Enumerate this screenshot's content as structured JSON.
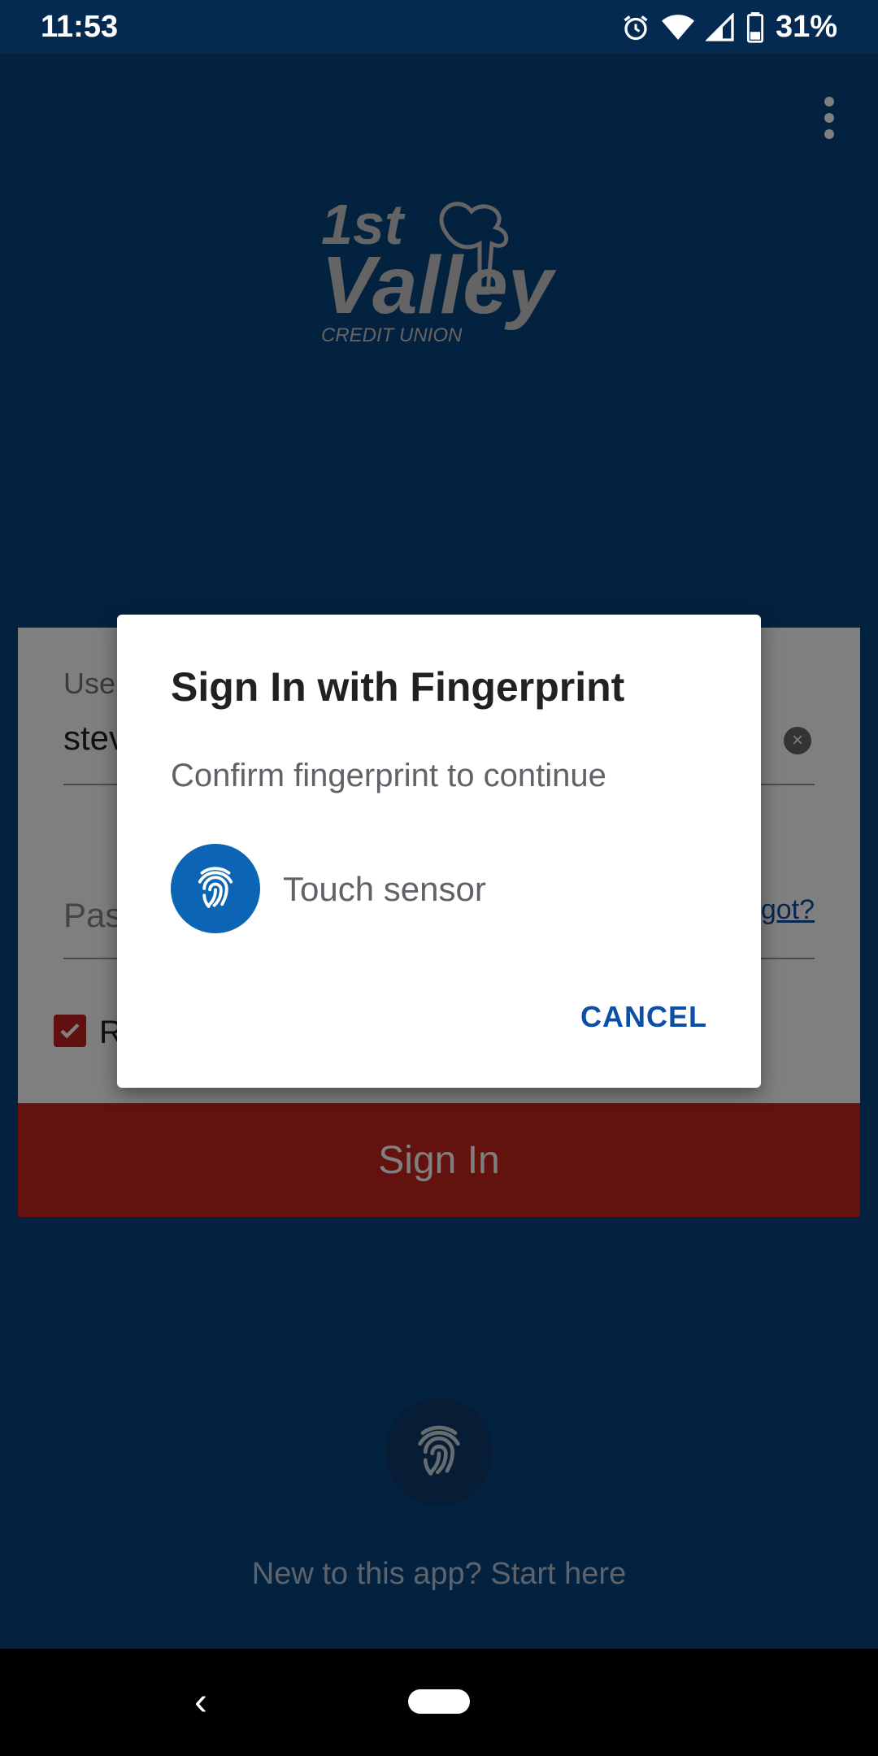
{
  "status_bar": {
    "time": "11:53",
    "battery": "31%",
    "icons": [
      "alarm-icon",
      "wifi-icon",
      "signal-icon",
      "battery-icon"
    ]
  },
  "app_bar": {
    "menu_icon": "overflow-menu-icon"
  },
  "logo": {
    "line1": "1st",
    "line2": "Valley",
    "line3": "CREDIT UNION"
  },
  "login": {
    "username_label": "Username",
    "username_value": "steve",
    "password_placeholder": "Password",
    "forgot_link": "Forgot?",
    "remember_label": "Remember me",
    "remember_checked": true,
    "signin_button": "Sign In"
  },
  "bottom": {
    "fingerprint_icon": "fingerprint-icon",
    "new_user_link": "New to this app? Start here"
  },
  "dialog": {
    "title": "Sign In with Fingerprint",
    "subtitle": "Confirm fingerprint to continue",
    "touch_label": "Touch sensor",
    "cancel_button": "CANCEL"
  },
  "nav_bar": {
    "back_icon": "back-icon",
    "home_icon": "home-pill-icon"
  },
  "colors": {
    "background": "#074480",
    "signin_button": "#c8241e",
    "dialog_accent": "#0b64b4",
    "cancel_text": "#0b4fa8"
  }
}
